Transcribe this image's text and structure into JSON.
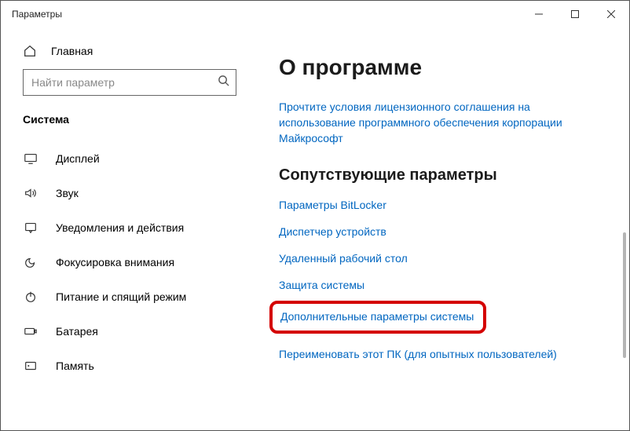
{
  "window": {
    "title": "Параметры"
  },
  "sidebar": {
    "home": "Главная",
    "search_placeholder": "Найти параметр",
    "section": "Система",
    "items": [
      {
        "label": "Дисплей"
      },
      {
        "label": "Звук"
      },
      {
        "label": "Уведомления и действия"
      },
      {
        "label": "Фокусировка внимания"
      },
      {
        "label": "Питание и спящий режим"
      },
      {
        "label": "Батарея"
      },
      {
        "label": "Память"
      }
    ]
  },
  "main": {
    "heading": "О программе",
    "license_link": "Прочтите условия лицензионного соглашения на использование программного обеспечения корпорации Майкрософт",
    "related_heading": "Сопутствующие параметры",
    "links": {
      "bitlocker": "Параметры BitLocker",
      "devmgr": "Диспетчер устройств",
      "rdp": "Удаленный рабочий стол",
      "sysprotect": "Защита системы",
      "advanced": "Дополнительные параметры системы",
      "rename": "Переименовать этот ПК (для опытных пользователей)"
    }
  }
}
